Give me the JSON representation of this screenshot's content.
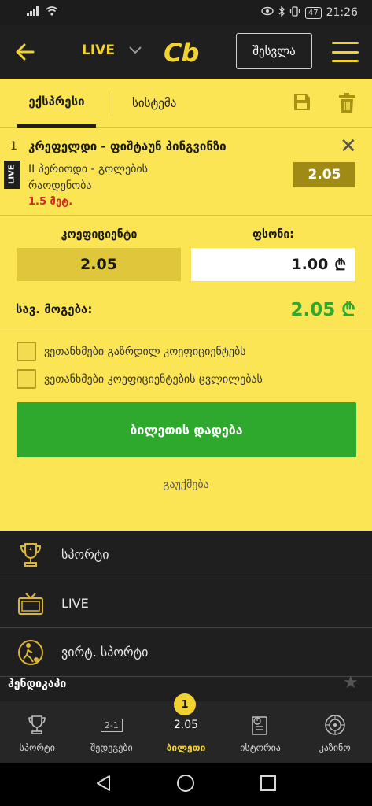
{
  "status": {
    "time": "21:26",
    "battery": "47"
  },
  "header": {
    "live_label": "LIVE",
    "logo": "Cb",
    "login_label": "შესვლა"
  },
  "tabs": {
    "express": "ექსპრესი",
    "system": "სისტემა"
  },
  "bet": {
    "number": "1",
    "live_badge": "LIVE",
    "match": "კრეფელდი - ფიშტაუნ პინგვინზი",
    "market": "II პერიოდი - გოლების რაოდენობა",
    "selection": "1.5 მეტ.",
    "odd": "2.05"
  },
  "summary": {
    "coef_label": "კოეფიციენტი",
    "stake_label": "ფსონი:",
    "coef_value": "2.05",
    "stake_value": "1.00",
    "currency": "₾",
    "total_label": "სავ. მოგება:",
    "total_value": "2.05 ₾"
  },
  "options": {
    "accept_increased": "ვეთანხმები გაზრდილ კოეფიციენტებს",
    "accept_changes": "ვეთანხმები კოეფიციენტების ცვლილებას"
  },
  "actions": {
    "place_bet": "ბილეთის დადება",
    "cancel": "გაუქმება"
  },
  "menu": [
    {
      "label": "სპორტი",
      "icon": "trophy-icon"
    },
    {
      "label": "LIVE",
      "icon": "tv-icon"
    },
    {
      "label": "ვირტ. სპორტი",
      "icon": "virtual-football-icon"
    }
  ],
  "partial_row": {
    "label": "ჰენდიკაპი"
  },
  "bottom_nav": [
    {
      "label": "სპორტი",
      "icon": "trophy-icon"
    },
    {
      "label": "შედეგები",
      "icon": "results-icon",
      "glyph": "2-1"
    },
    {
      "label": "ბილეთი",
      "icon": "ticket-icon",
      "badge": "1",
      "odd": "2.05"
    },
    {
      "label": "ისტორია",
      "icon": "history-icon"
    },
    {
      "label": "კაზინო",
      "icon": "casino-icon"
    }
  ],
  "colors": {
    "accent": "#f2d230",
    "slip_bg": "#fbe555",
    "green": "#2fa82e",
    "red": "#d8252c",
    "dark": "#1f1f1f"
  }
}
